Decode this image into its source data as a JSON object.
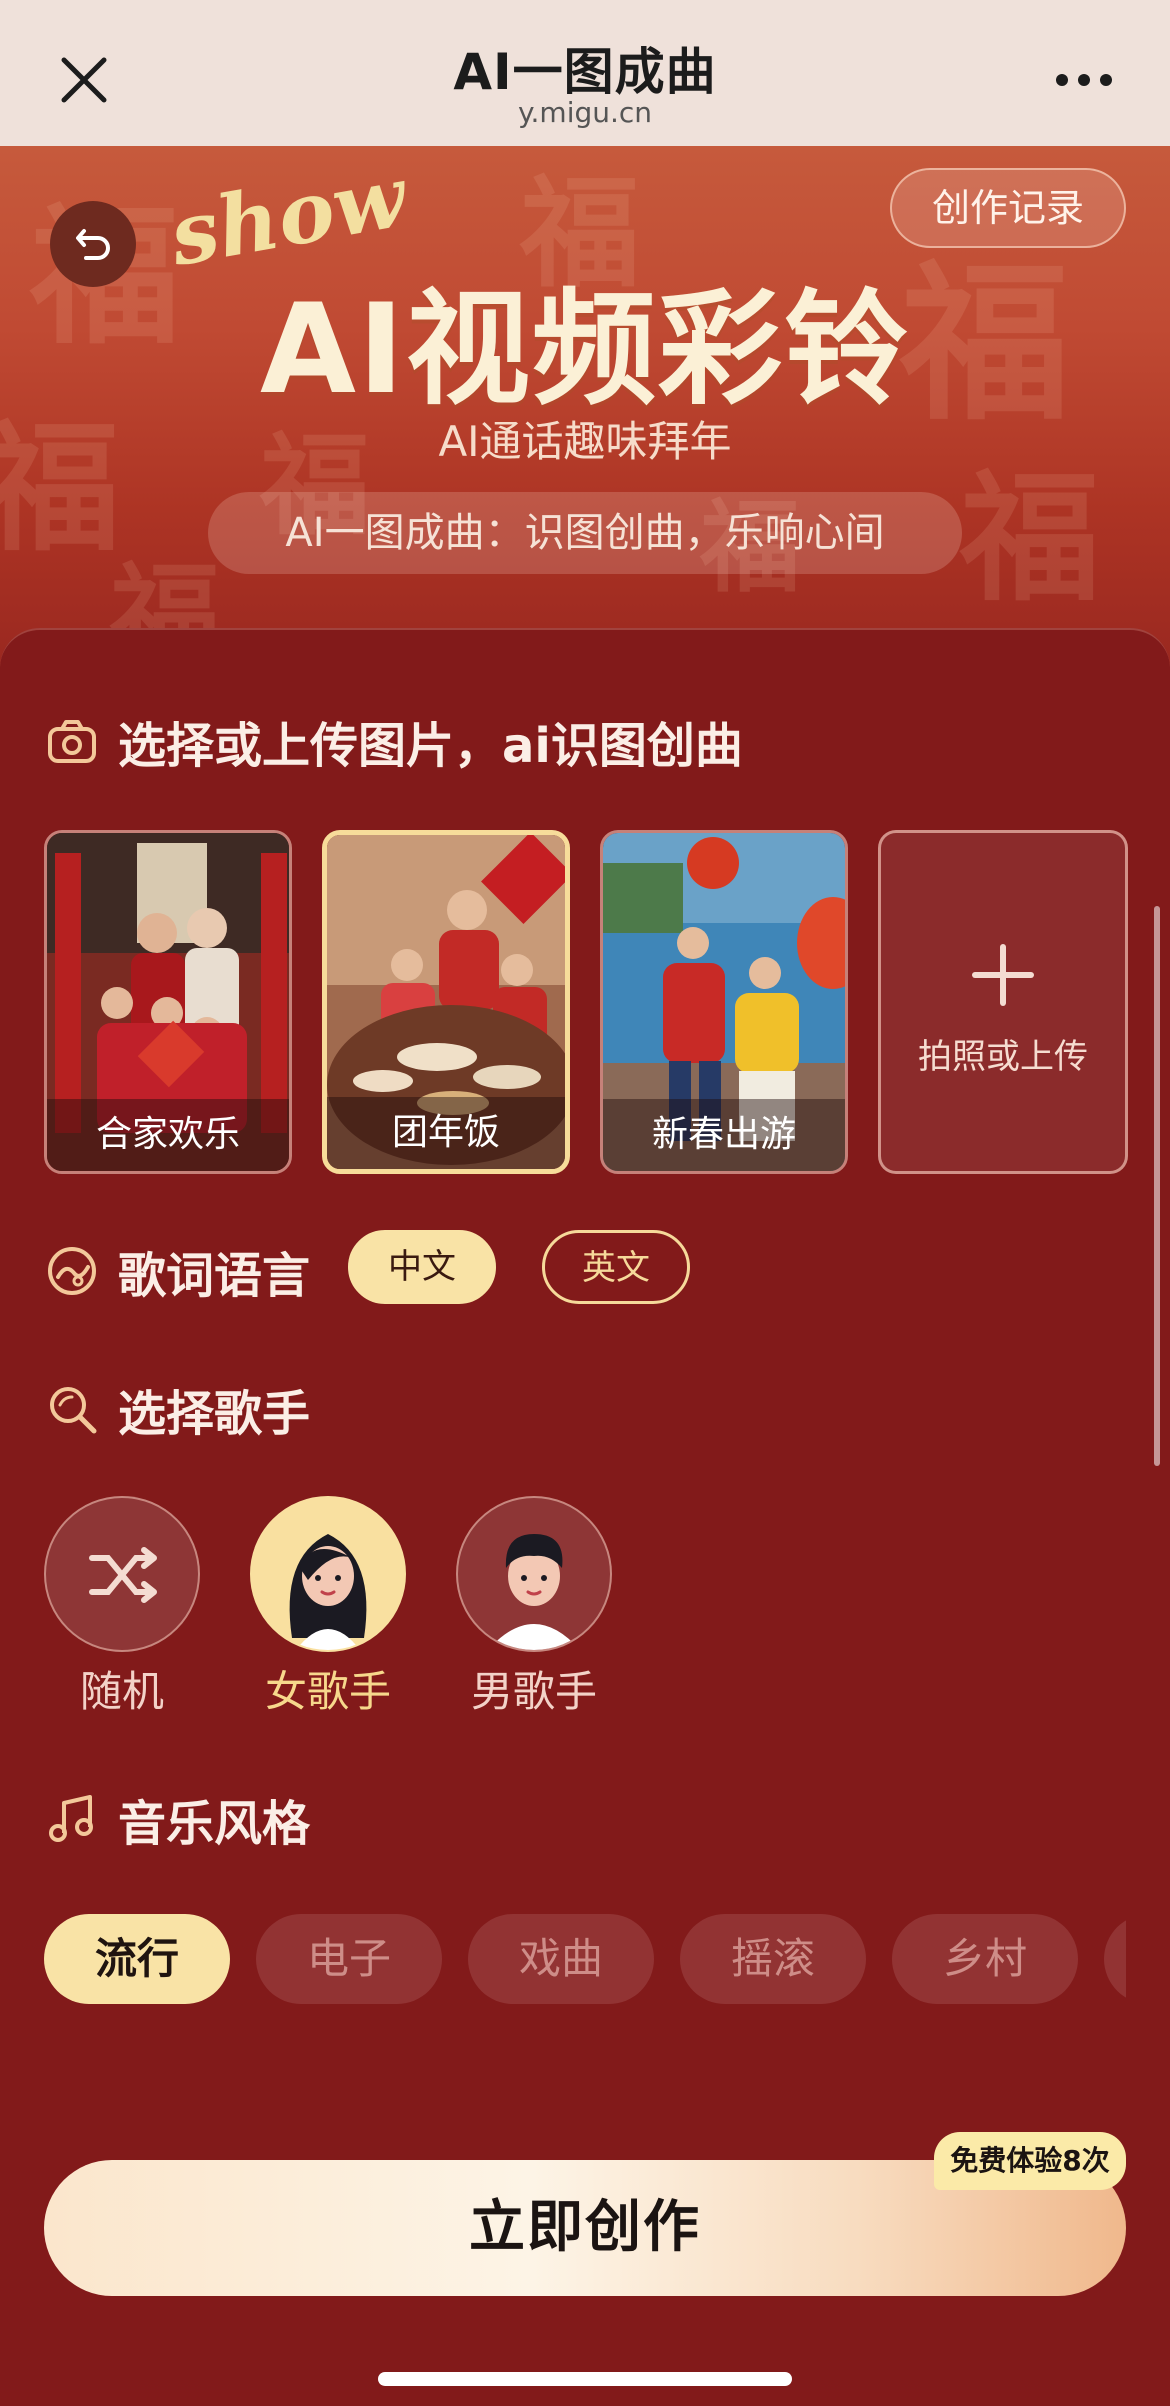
{
  "browser": {
    "title": "AI一图成曲",
    "url": "y.migu.cn",
    "close_icon": "close-icon",
    "more_icon": "more-dots-icon"
  },
  "hero": {
    "record_button": "创作记录",
    "show_word": "show",
    "title": "AI视频彩铃",
    "subtitle": "AI通话趣味拜年",
    "slogan": "AI一图成曲：识图创曲，乐响心间",
    "back_icon": "back-arrow-icon",
    "pattern_chars": [
      "福",
      "福",
      "福",
      "福",
      "福",
      "福",
      "福",
      "福"
    ]
  },
  "image_section": {
    "title": "选择或上传图片，ai识图创曲",
    "icon": "camera-icon",
    "images": [
      {
        "caption": "合家欢乐",
        "selected": false
      },
      {
        "caption": "团年饭",
        "selected": true
      },
      {
        "caption": "新春出游",
        "selected": false
      }
    ],
    "upload_label": "拍照或上传"
  },
  "language_section": {
    "title": "歌词语言",
    "icon": "language-icon",
    "options": [
      {
        "label": "中文",
        "active": true
      },
      {
        "label": "英文",
        "active": false
      }
    ]
  },
  "singer_section": {
    "title": "选择歌手",
    "icon": "search-icon",
    "singers": [
      {
        "label": "随机",
        "active": false
      },
      {
        "label": "女歌手",
        "active": true
      },
      {
        "label": "男歌手",
        "active": false
      }
    ]
  },
  "style_section": {
    "title": "音乐风格",
    "icon": "music-note-icon",
    "styles": [
      {
        "label": "流行",
        "active": true
      },
      {
        "label": "电子",
        "active": false
      },
      {
        "label": "戏曲",
        "active": false
      },
      {
        "label": "摇滚",
        "active": false
      },
      {
        "label": "乡村",
        "active": false
      },
      {
        "label": "",
        "active": false
      }
    ]
  },
  "cta": {
    "label": "立即创作",
    "badge": "免费体验8次"
  },
  "colors": {
    "page_bg": "#821a1a",
    "accent_gold": "#f9e3a6",
    "hero_red": "#c04a33"
  }
}
